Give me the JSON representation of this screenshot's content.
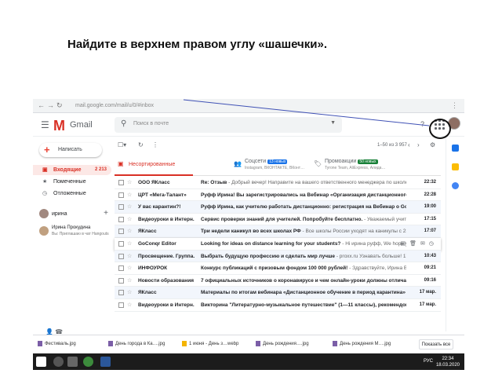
{
  "instruction": "Найдите в верхнем правом углу «шашечки».",
  "browser": {
    "url": "mail.google.com/mail/u/0/#inbox"
  },
  "gmail": {
    "brand": "Gmail",
    "search_placeholder": "Поиск в почте",
    "compose_label": "Написать"
  },
  "sidebar": {
    "items": [
      {
        "label": "Входящие",
        "count": "2 213",
        "icon": "inbox-icon"
      },
      {
        "label": "Помеченные",
        "count": "",
        "icon": "star-icon"
      },
      {
        "label": "Отложенные",
        "count": "",
        "icon": "clock-icon"
      }
    ],
    "hangouts_user": "ирина",
    "contact_name": "Ирина Прокудина",
    "contact_status": "Вы: Приглашаю в чат Hangouts"
  },
  "toolbar": {
    "count": "1–50 из 3 957"
  },
  "tabs": [
    {
      "label": "Несортированные",
      "badge": "",
      "sub": ""
    },
    {
      "label": "Соцсети",
      "badge": "13 новых",
      "badge_color": "#1a73e8",
      "sub": "Instagram, ВКОНТАКТЕ, ВКонт…"
    },
    {
      "label": "Промоакции",
      "badge": "50 новых",
      "badge_color": "#188038",
      "sub": "Tyrone Team, AliExpress, Алида…"
    }
  ],
  "mails": [
    {
      "sender": "ООО ЯКласс",
      "subject": "Re: Отзыв",
      "snippet": " - Добрый вечер! Направите на вашего ответственного менеджера по школе. Он св…",
      "date": "22:32",
      "read": false
    },
    {
      "sender": "ЦРТ «Мега-Талант»",
      "subject": "Руфф Ирина! Вы зарегистрировались на Вебинар «Организация дистанционного обучения на…",
      "snippet": "",
      "date": "22:28",
      "read": false
    },
    {
      "sender": "У вас карантин?!",
      "subject": "Руфф Ирина, как учителю работать дистанционно: регистрация на Вебинар о Google Classroo…",
      "snippet": "",
      "date": "19:00",
      "read": true
    },
    {
      "sender": "Видеоуроки в Интерн.",
      "subject": "Сервис проверки знаний для учителей. Попробуйте бесплатно.",
      "snippet": " - Уважаемый учитель изв…",
      "date": "17:15",
      "read": false
    },
    {
      "sender": "ЯКласс",
      "subject": "Три недели каникул во всех школах РФ",
      "snippet": " - Все школы России уходят на каникулы с 23 марта до…",
      "date": "17:07",
      "read": true
    },
    {
      "sender": "GoConqr Editor",
      "subject": "Looking for ideas on distance learning for your students?",
      "snippet": " - Hi ирина руфф, We hope you…",
      "date": "",
      "read": false,
      "hover": true
    },
    {
      "sender": "Просвещение. Группа.",
      "subject": "Выбрать будущую профессию и сделать мир лучше",
      "snippet": " - proxx.ru Узнавать больше! 17 марта – Ве…",
      "date": "10:43",
      "read": true
    },
    {
      "sender": "ИНФОУРОК",
      "subject": "Конкурс публикаций с призовым фондом 100 000 рублей!",
      "snippet": " - Здравствуйте, Ирина Васильевна!…",
      "date": "09:21",
      "read": false
    },
    {
      "sender": "Новости образования",
      "subject": "7 официальных источников о коронавирусе и чем онлайн-уроки должны отличаться от оффл…",
      "snippet": "",
      "date": "09:16",
      "read": false
    },
    {
      "sender": "ЯКласс",
      "subject": "Материалы по итогам вебинара «Дистанционное обучение в период карантина»",
      "snippet": " - Здравств…",
      "date": "17 мар.",
      "read": true
    },
    {
      "sender": "Видеоуроки в Интерн.",
      "subject": "Викторина \"Литературно-музыкальное путешествие\" (1—11 классы), рекомендованная Мин…",
      "snippet": "",
      "date": "17 мар.",
      "read": false
    }
  ],
  "downloads": {
    "items": [
      "Фестиваль.jpg",
      "День города в Ка….jpg",
      "1 июня - День з…webp",
      "День рождения….jpg",
      "День рождения М….jpg"
    ],
    "show_all": "Показать все"
  },
  "taskbar": {
    "lang": "РУС",
    "time": "22:34",
    "date": "18.03.2020"
  }
}
